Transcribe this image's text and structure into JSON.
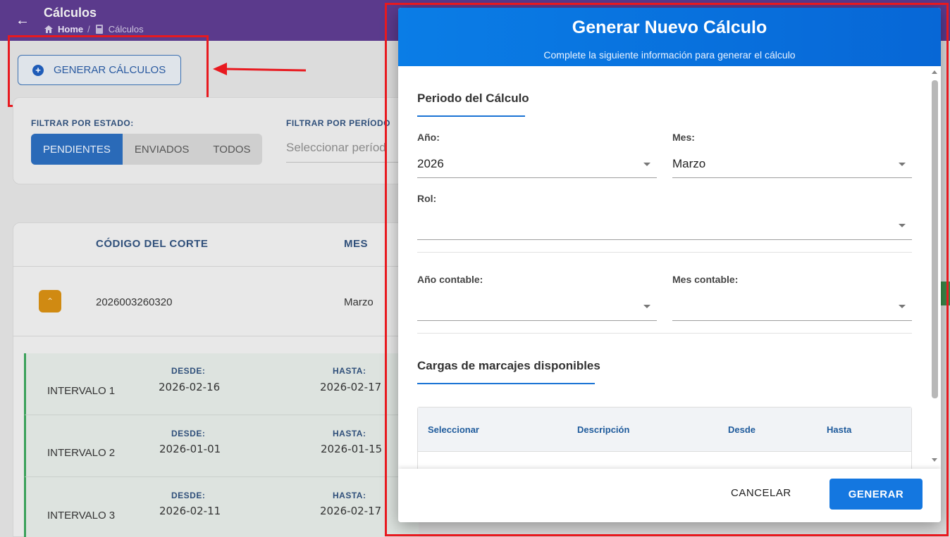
{
  "header": {
    "title": "Cálculos",
    "breadcrumb": {
      "home": "Home",
      "separator": "/",
      "current": "Cálculos"
    }
  },
  "actions": {
    "generate_button": "GENERAR CÁLCULOS"
  },
  "filters": {
    "status_label": "FILTRAR POR ESTADO:",
    "status_options": [
      "PENDIENTES",
      "ENVIADOS",
      "TODOS"
    ],
    "status_selected": "PENDIENTES",
    "period_label": "FILTRAR POR PERÍODO",
    "period_placeholder": "Seleccionar períod"
  },
  "table": {
    "headers": [
      "CÓDIGO DEL CORTE",
      "MES"
    ],
    "rows": [
      {
        "codigo": "2026003260320",
        "mes": "Marzo"
      }
    ],
    "intervals": [
      {
        "name": "INTERVALO 1",
        "desde_label": "DESDE:",
        "desde": "2026-02-16",
        "hasta_label": "HASTA:",
        "hasta": "2026-02-17"
      },
      {
        "name": "INTERVALO 2",
        "desde_label": "DESDE:",
        "desde": "2026-01-01",
        "hasta_label": "HASTA:",
        "hasta": "2026-01-15"
      },
      {
        "name": "INTERVALO 3",
        "desde_label": "DESDE:",
        "desde": "2026-02-11",
        "hasta_label": "HASTA:",
        "hasta": "2026-02-17"
      }
    ]
  },
  "modal": {
    "title": "Generar Nuevo Cálculo",
    "subtitle": "Complete la siguiente información para generar el cálculo",
    "section_period": "Periodo del Cálculo",
    "fields": {
      "anio": {
        "label": "Año:",
        "value": "2026"
      },
      "mes": {
        "label": "Mes:",
        "value": "Marzo"
      },
      "rol": {
        "label": "Rol:",
        "value": ""
      },
      "anio_contable": {
        "label": "Año contable:",
        "value": ""
      },
      "mes_contable": {
        "label": "Mes contable:",
        "value": ""
      }
    },
    "section_cargas": "Cargas de marcajes disponibles",
    "cargas_headers": [
      "Seleccionar",
      "Descripción",
      "Desde",
      "Hasta"
    ],
    "cancel_label": "CANCELAR",
    "generate_label": "GENERAR"
  },
  "colors": {
    "modal_header": "#0a7de6",
    "primary_button": "#1477e0",
    "annotation_red": "#e8191f",
    "top_bar": "#5b3a8c"
  }
}
